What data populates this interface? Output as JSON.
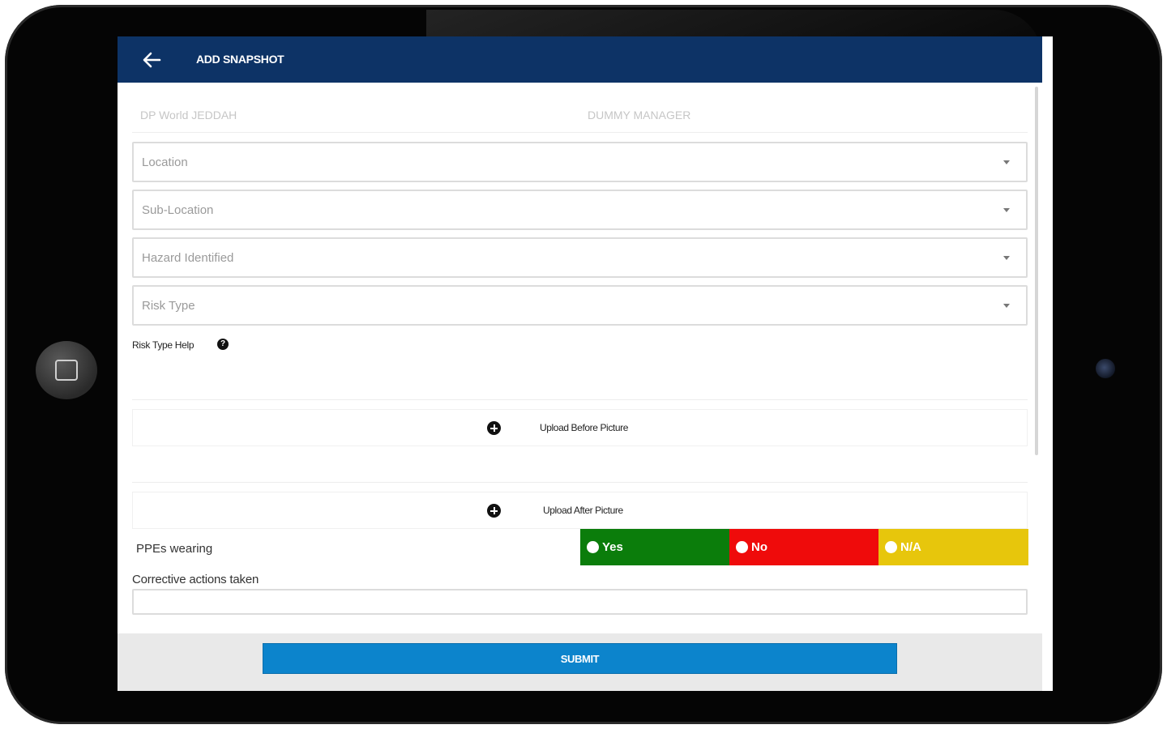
{
  "appbar": {
    "title": "ADD SNAPSHOT",
    "background": "#0d3366"
  },
  "info": {
    "company": "DP World JEDDAH",
    "manager": "DUMMY MANAGER"
  },
  "form": {
    "dropdowns": [
      {
        "placeholder": "Location"
      },
      {
        "placeholder": "Sub-Location"
      },
      {
        "placeholder": "Hazard Identified"
      },
      {
        "placeholder": "Risk Type"
      }
    ],
    "risk_help_label": "Risk Type Help",
    "help_icon_glyph": "?",
    "upload_before_label": "Upload Before Picture",
    "upload_after_label": "Upload After Picture",
    "ppe": {
      "label": "PPEs wearing",
      "options": [
        {
          "label": "Yes",
          "color": "#0b7d0b"
        },
        {
          "label": "No",
          "color": "#ef0b0b"
        },
        {
          "label": "N/A",
          "color": "#e7c60c"
        }
      ]
    },
    "corrective_label": "Corrective actions taken",
    "corrective_value": ""
  },
  "footer": {
    "submit_label": "SUBMIT",
    "submit_color": "#0c84cc"
  }
}
